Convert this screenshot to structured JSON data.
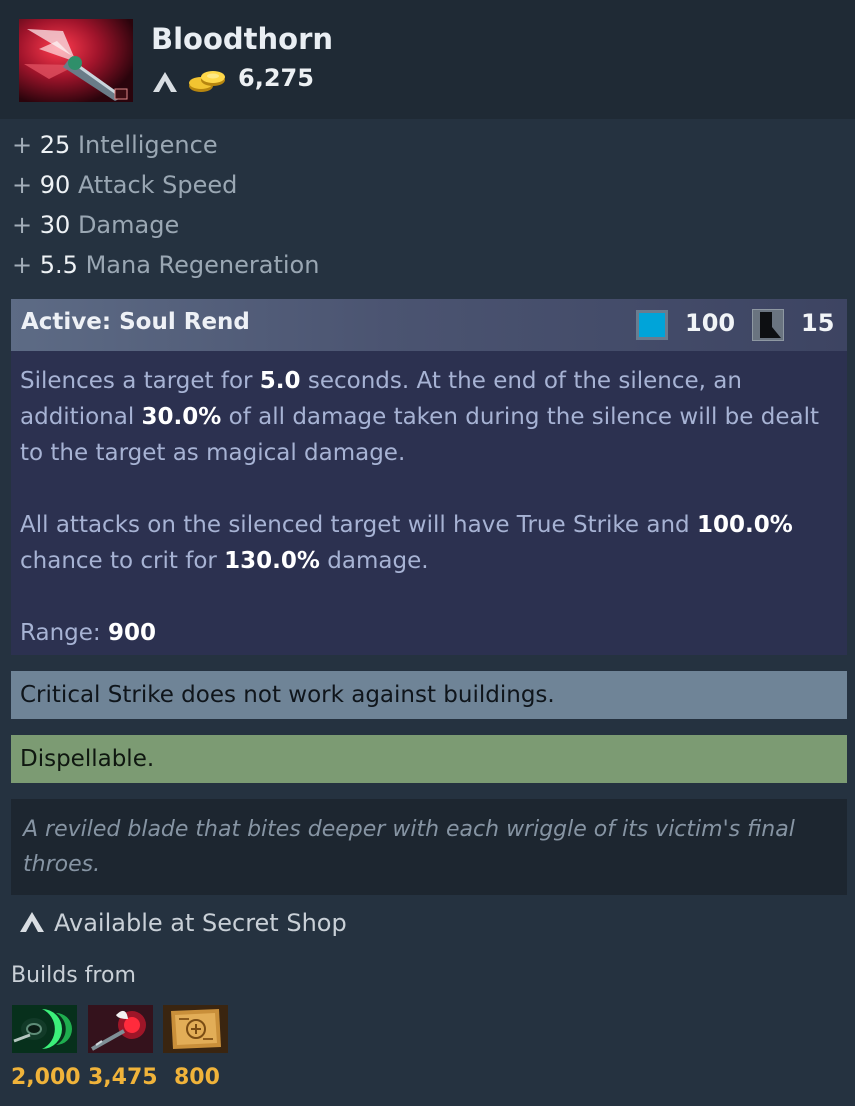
{
  "item": {
    "name": "Bloodthorn",
    "icon": "bloodthorn-item-icon",
    "shop_icon": "secret-shop-icon",
    "gold_icon": "gold-coins-icon",
    "cost": "6,275"
  },
  "attributes": [
    {
      "plus": "+",
      "value": "25",
      "name": "Intelligence"
    },
    {
      "plus": "+",
      "value": "90",
      "name": "Attack Speed"
    },
    {
      "plus": "+",
      "value": "30",
      "name": "Damage"
    },
    {
      "plus": "+",
      "value": "5.5",
      "name": "Mana Regeneration"
    }
  ],
  "active": {
    "title": "Active: Soul Rend",
    "mana_icon": "mana-cost-icon",
    "mana_cost": "100",
    "cooldown_icon": "cooldown-icon",
    "cooldown": "15",
    "desc1": {
      "t1": "Silences a target for ",
      "v1": "5.0",
      "t2": " seconds. At the end of the silence, an additional ",
      "v2": "30.0%",
      "t3": " of all damage taken during the silence will be dealt to the target as magical damage."
    },
    "desc2": {
      "t1": "All attacks on the silenced target will have True Strike and ",
      "v1": "100.0%",
      "t2": " chance to crit for ",
      "v2": "130.0%",
      "t3": " damage."
    },
    "range_label": "Range: ",
    "range_value": "900"
  },
  "note": "Critical Strike does not work against buildings.",
  "dispel": "Dispellable.",
  "lore": "A reviled blade that bites deeper with each wriggle of its victim's final throes.",
  "availability": "Available at Secret Shop",
  "builds_from": {
    "label": "Builds from",
    "components": [
      {
        "icon": "hyperstone-icon",
        "cost": "2,000"
      },
      {
        "icon": "orchid-malevolence-icon",
        "cost": "3,475"
      },
      {
        "icon": "recipe-scroll-icon",
        "cost": "800"
      }
    ]
  },
  "colors": {
    "background": "#253240",
    "active_panel": "#2c3150",
    "note_bar": "#6f8497",
    "dispel_bar": "#7c9b73",
    "gold_text": "#f0b33a",
    "mana_blue": "#00a4d9"
  }
}
